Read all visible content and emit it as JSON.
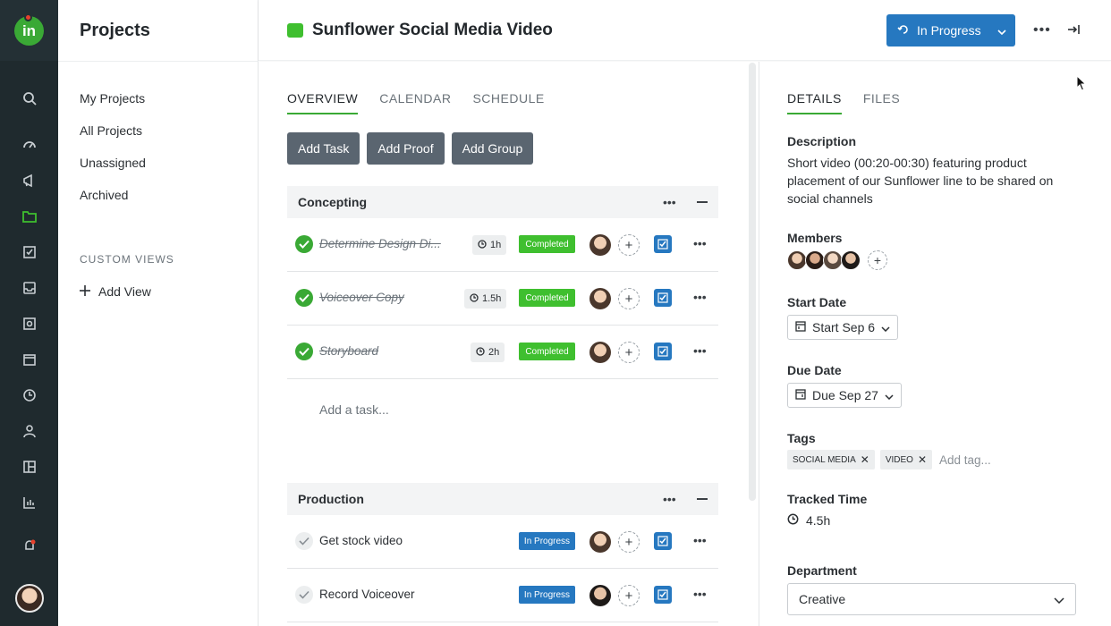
{
  "nav": {
    "title": "Projects",
    "items": [
      {
        "label": "My Projects"
      },
      {
        "label": "All Projects"
      },
      {
        "label": "Unassigned"
      },
      {
        "label": "Archived"
      }
    ],
    "custom_views_heading": "CUSTOM VIEWS",
    "add_view_label": "Add View"
  },
  "header": {
    "project_title": "Sunflower Social Media Video",
    "status_label": "In Progress"
  },
  "main": {
    "tabs": [
      {
        "label": "OVERVIEW",
        "active": true
      },
      {
        "label": "CALENDAR",
        "active": false
      },
      {
        "label": "SCHEDULE",
        "active": false
      }
    ],
    "actions": {
      "add_task": "Add Task",
      "add_proof": "Add Proof",
      "add_group": "Add Group"
    },
    "groups": [
      {
        "name": "Concepting",
        "tasks": [
          {
            "name": "Determine Design Di...",
            "time": "1h",
            "status": "Completed"
          },
          {
            "name": "Voiceover Copy",
            "time": "1.5h",
            "status": "Completed"
          },
          {
            "name": "Storyboard",
            "time": "2h",
            "status": "Completed"
          }
        ],
        "add_task_placeholder": "Add a task..."
      },
      {
        "name": "Production",
        "tasks": [
          {
            "name": "Get stock video",
            "status": "In Progress"
          },
          {
            "name": "Record Voiceover",
            "status": "In Progress"
          }
        ]
      }
    ]
  },
  "details": {
    "tabs": [
      {
        "label": "DETAILS",
        "active": true
      },
      {
        "label": "FILES",
        "active": false
      }
    ],
    "description_label": "Description",
    "description": "Short video (00:20-00:30) featuring product placement of our Sunflower line to be shared on social channels",
    "members_label": "Members",
    "start_date_label": "Start Date",
    "start_date": "Start Sep 6",
    "due_date_label": "Due Date",
    "due_date": "Due Sep 27",
    "tags_label": "Tags",
    "tags": [
      "SOCIAL MEDIA",
      "VIDEO"
    ],
    "tag_placeholder": "Add tag...",
    "tracked_time_label": "Tracked Time",
    "tracked_time": "4.5h",
    "department_label": "Department",
    "department": "Creative"
  },
  "colors": {
    "accent_green": "#3aa935",
    "primary_blue": "#2678c0",
    "rail_bg": "#1f2a2e"
  }
}
